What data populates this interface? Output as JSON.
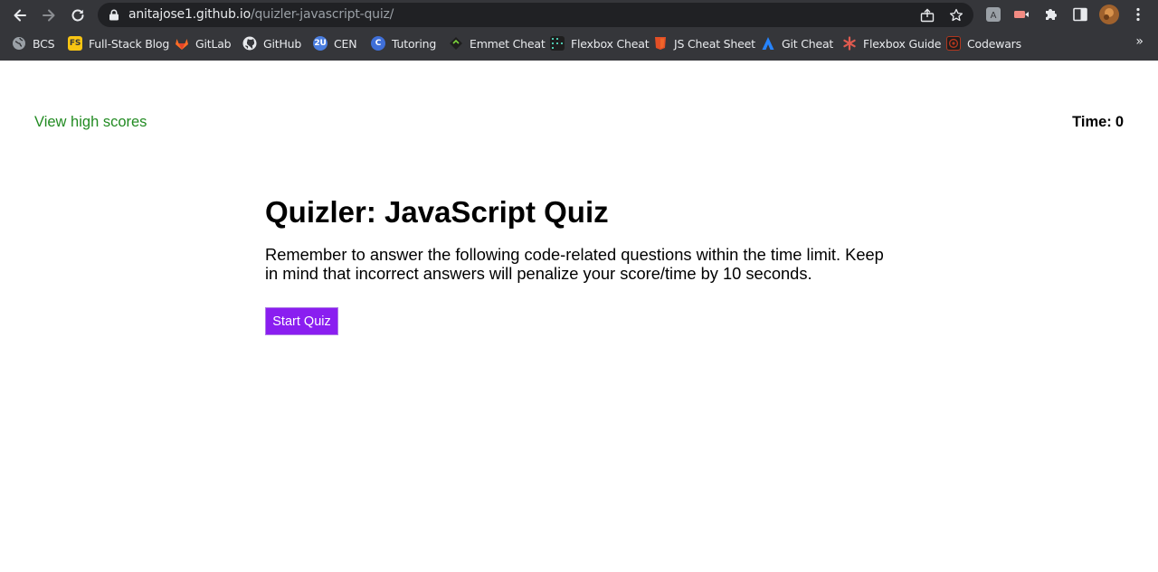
{
  "browser": {
    "url_host": "anitajose1.github.io",
    "url_path": "/quizler-javascript-quiz/",
    "bookmarks": [
      {
        "label": "BCS",
        "icon": "globe-icon"
      },
      {
        "label": "Full-Stack Blog",
        "icon": "fs-icon"
      },
      {
        "label": "GitLab",
        "icon": "gitlab-icon"
      },
      {
        "label": "GitHub",
        "icon": "github-icon"
      },
      {
        "label": "CEN",
        "icon": "2u-icon"
      },
      {
        "label": "Tutoring",
        "icon": "c-circle-icon"
      },
      {
        "label": "Emmet Cheat",
        "icon": "emmet-icon"
      },
      {
        "label": "Flexbox Cheat",
        "icon": "grid-dots-icon"
      },
      {
        "label": "JS Cheat Sheet",
        "icon": "shield-icon"
      },
      {
        "label": "Git Cheat",
        "icon": "atlassian-icon"
      },
      {
        "label": "Flexbox Guide",
        "icon": "asterisk-icon"
      },
      {
        "label": "Codewars",
        "icon": "codewars-icon"
      }
    ],
    "more_label": "»"
  },
  "header": {
    "high_scores_link": "View high scores",
    "timer_label": "Time:",
    "timer_value": "0"
  },
  "quiz": {
    "title": "Quizler: JavaScript Quiz",
    "description": "Remember to answer the following code-related questions within the time limit. Keep in mind that incorrect answers will penalize your score/time by 10 seconds.",
    "start_button": "Start Quiz"
  },
  "colors": {
    "link": "#228b22",
    "button": "#8a1ef0",
    "chrome": "#35363a"
  }
}
